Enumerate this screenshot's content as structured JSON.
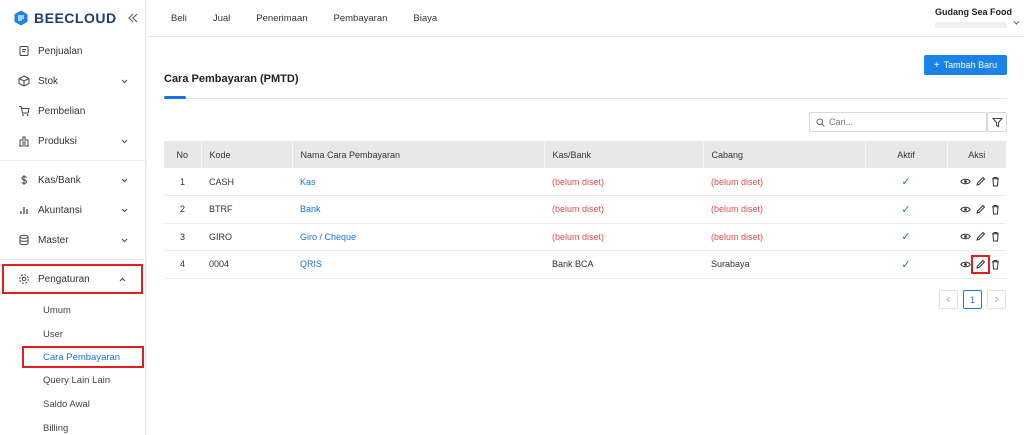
{
  "brand": {
    "name": "BEECLOUD"
  },
  "sidebar": {
    "items": [
      {
        "label": "Penjualan",
        "icon": "receipt-icon",
        "chevron": false
      },
      {
        "label": "Stok",
        "icon": "box-icon",
        "chevron": true
      },
      {
        "label": "Pembelian",
        "icon": "cart-icon",
        "chevron": false
      },
      {
        "label": "Produksi",
        "icon": "factory-icon",
        "chevron": true
      },
      {
        "label": "Kas/Bank",
        "icon": "dollar-icon",
        "chevron": true
      },
      {
        "label": "Akuntansi",
        "icon": "bar-chart-icon",
        "chevron": true
      },
      {
        "label": "Master",
        "icon": "database-icon",
        "chevron": true
      },
      {
        "label": "Pengaturan",
        "icon": "gear-icon",
        "chevron": true
      }
    ],
    "submenu": [
      "Umum",
      "User",
      "Cara Pembayaran",
      "Query Lain Lain",
      "Saldo Awal",
      "Billing"
    ]
  },
  "topnav": [
    "Beli",
    "Jual",
    "Penerimaan",
    "Pembayaran",
    "Biaya"
  ],
  "company": {
    "name": "Gudang Sea Food"
  },
  "page": {
    "title": "Cara Pembayaran (PMTD)",
    "add_label": "Tambah Baru",
    "search_placeholder": "Cari..."
  },
  "table": {
    "headers": [
      "No",
      "Kode",
      "Nama Cara Pembayaran",
      "Kas/Bank",
      "Cabang",
      "Aktif",
      "Aksi"
    ],
    "rows": [
      {
        "no": "1",
        "kode": "CASH",
        "nama": "Kas",
        "kasbank": "(belum diset)",
        "cabang": "(belum diset)",
        "aktif": "✓"
      },
      {
        "no": "2",
        "kode": "BTRF",
        "nama": "Bank",
        "kasbank": "(belum diset)",
        "cabang": "(belum diset)",
        "aktif": "✓"
      },
      {
        "no": "3",
        "kode": "GIRO",
        "nama": "Giro / Cheque",
        "kasbank": "(belum diset)",
        "cabang": "(belum diset)",
        "aktif": "✓"
      },
      {
        "no": "4",
        "kode": "0004",
        "nama": "QRIS",
        "kasbank": "Bank BCA",
        "cabang": "Surabaya",
        "aktif": "✓"
      }
    ]
  },
  "pagination": {
    "current": "1"
  },
  "colors": {
    "accent": "#1a73e8",
    "warning": "#e05050",
    "highlight": "#e02020"
  }
}
